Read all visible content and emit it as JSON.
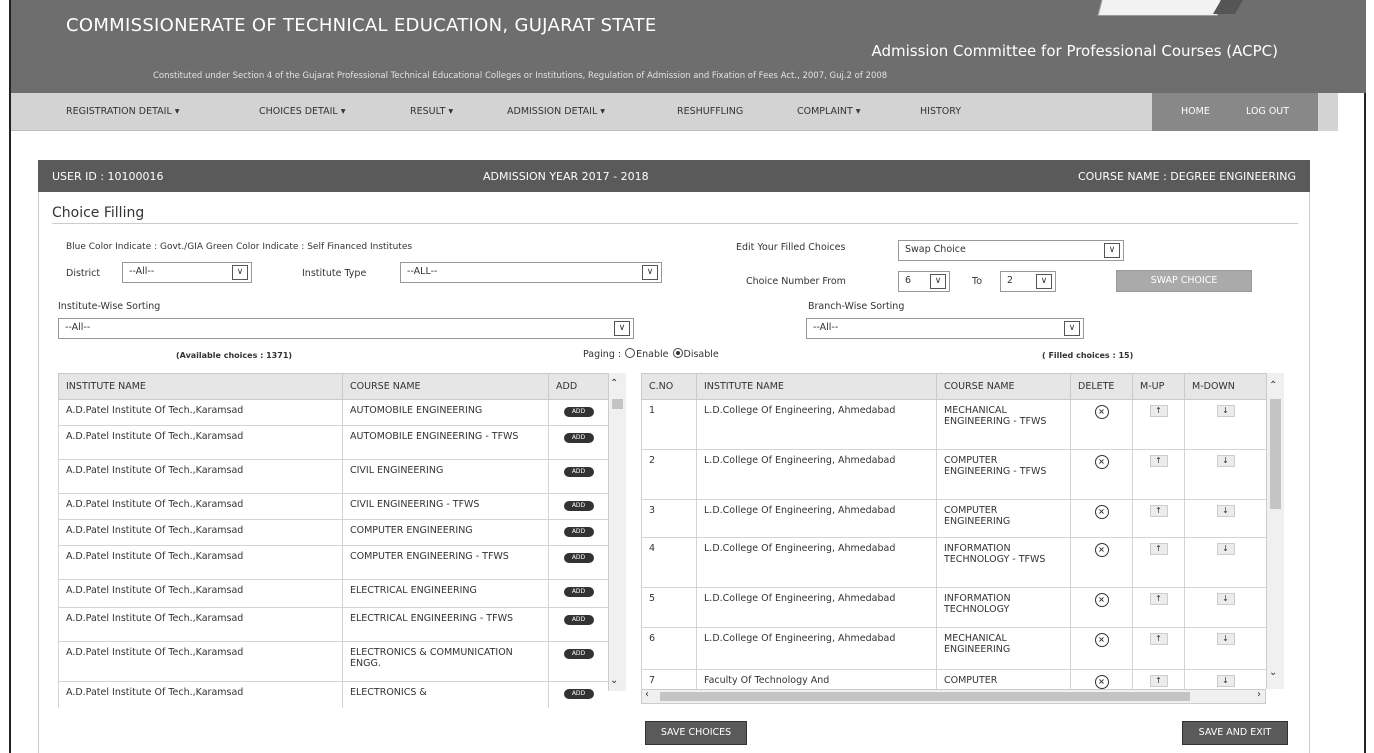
{
  "header": {
    "title": "COMMISSIONERATE OF TECHNICAL EDUCATION, GUJARAT STATE",
    "subtitle": "Admission Committee for Professional Courses (ACPC)",
    "constituted": "Constituted under Section 4 of the Gujarat Professional Technical Educational Colleges or Institutions, Regulation of Admission and Fixation of Fees Act., 2007, Guj.2 of 2008"
  },
  "nav": {
    "items": [
      "REGISTRATION DETAIL ▾",
      "CHOICES DETAIL ▾",
      "RESULT ▾",
      "ADMISSION DETAIL ▾",
      "RESHUFFLING",
      "COMPLAINT ▾",
      "HISTORY"
    ],
    "home": "HOME",
    "logout": "LOG OUT"
  },
  "info_bar": {
    "user_id": "USER ID : 10100016",
    "year": "ADMISSION YEAR 2017 - 2018",
    "course": "COURSE NAME : DEGREE ENGINEERING"
  },
  "choice": {
    "title": "Choice Filling",
    "legend": "Blue Color Indicate : Govt./GIA Green Color Indicate : Self Financed Institutes",
    "district_label": "District",
    "district_value": "--All--",
    "inst_type_label": "Institute Type",
    "inst_type_value": "--ALL--",
    "edit_label": "Edit Your Filled Choices",
    "edit_value": "Swap Choice",
    "from_label": "Choice Number From",
    "from_value": "6",
    "to_label": "To",
    "to_value": "2",
    "swap_button": "SWAP CHOICE",
    "inst_sort_label": "Institute-Wise Sorting",
    "inst_sort_value": "--All--",
    "branch_sort_label": "Branch-Wise Sorting",
    "branch_sort_value": "--All--",
    "available": "(Available choices : 1371)",
    "paging_label": "Paging :",
    "paging_enable": "Enable",
    "paging_disable": "Disable",
    "filled": "( Filled choices : 15)"
  },
  "available_table": {
    "headers": [
      "INSTITUTE NAME",
      "COURSE NAME",
      "ADD"
    ],
    "add_label": "ADD",
    "rows": [
      [
        "A.D.Patel Institute Of Tech.,Karamsad",
        "AUTOMOBILE ENGINEERING"
      ],
      [
        "A.D.Patel Institute Of Tech.,Karamsad",
        "AUTOMOBILE ENGINEERING - TFWS"
      ],
      [
        "A.D.Patel Institute Of Tech.,Karamsad",
        "CIVIL ENGINEERING"
      ],
      [
        "A.D.Patel Institute Of Tech.,Karamsad",
        "CIVIL ENGINEERING - TFWS"
      ],
      [
        "A.D.Patel Institute Of Tech.,Karamsad",
        "COMPUTER ENGINEERING"
      ],
      [
        "A.D.Patel Institute Of Tech.,Karamsad",
        "COMPUTER ENGINEERING - TFWS"
      ],
      [
        "A.D.Patel Institute Of Tech.,Karamsad",
        "ELECTRICAL ENGINEERING"
      ],
      [
        "A.D.Patel Institute Of Tech.,Karamsad",
        "ELECTRICAL ENGINEERING - TFWS"
      ],
      [
        "A.D.Patel Institute Of Tech.,Karamsad",
        "ELECTRONICS & COMMUNICATION ENGG."
      ],
      [
        "A.D.Patel Institute Of Tech.,Karamsad",
        "ELECTRONICS &"
      ]
    ]
  },
  "filled_table": {
    "headers": [
      "C.NO",
      "INSTITUTE NAME",
      "COURSE NAME",
      "DELETE",
      "M-UP",
      "M-DOWN"
    ],
    "rows": [
      [
        "1",
        "L.D.College Of Engineering, Ahmedabad",
        "MECHANICAL ENGINEERING - TFWS"
      ],
      [
        "2",
        "L.D.College Of Engineering, Ahmedabad",
        "COMPUTER ENGINEERING - TFWS"
      ],
      [
        "3",
        "L.D.College Of Engineering, Ahmedabad",
        "COMPUTER ENGINEERING"
      ],
      [
        "4",
        "L.D.College Of Engineering, Ahmedabad",
        "INFORMATION TECHNOLOGY - TFWS"
      ],
      [
        "5",
        "L.D.College Of Engineering, Ahmedabad",
        "INFORMATION TECHNOLOGY"
      ],
      [
        "6",
        "L.D.College Of Engineering, Ahmedabad",
        "MECHANICAL ENGINEERING"
      ],
      [
        "7",
        "Faculty Of Technology And",
        "COMPUTER"
      ]
    ]
  },
  "buttons": {
    "save": "SAVE CHOICES",
    "save_exit": "SAVE AND EXIT"
  },
  "icons": {
    "delete": "circle-x-icon",
    "move_up": "arrow-up-icon",
    "move_down": "arrow-down-icon"
  }
}
